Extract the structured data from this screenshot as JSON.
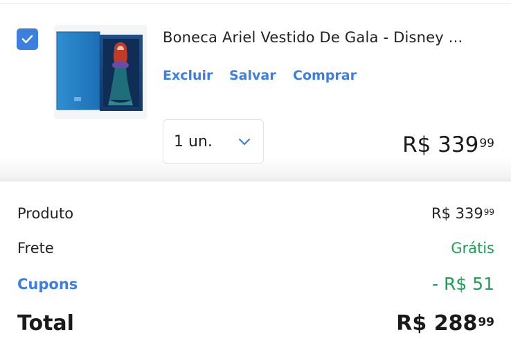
{
  "colors": {
    "accent": "#3d7fe0",
    "green": "#1e9f55",
    "text": "#222222"
  },
  "item": {
    "checked": true,
    "title": "Boneca Ariel Vestido De Gala - Disney ...",
    "actions": {
      "delete": "Excluir",
      "save": "Salvar",
      "buy": "Comprar"
    },
    "quantity": "1 un.",
    "price_main": "R$ 339",
    "price_cents": "99"
  },
  "summary": {
    "product_label": "Produto",
    "product_main": "R$ 339",
    "product_cents": "99",
    "shipping_label": "Frete",
    "shipping_value": "Grátis",
    "coupons_label": "Cupons",
    "coupons_value": "- R$ 51",
    "total_label": "Total",
    "total_main": "R$ 288",
    "total_cents": "99"
  }
}
